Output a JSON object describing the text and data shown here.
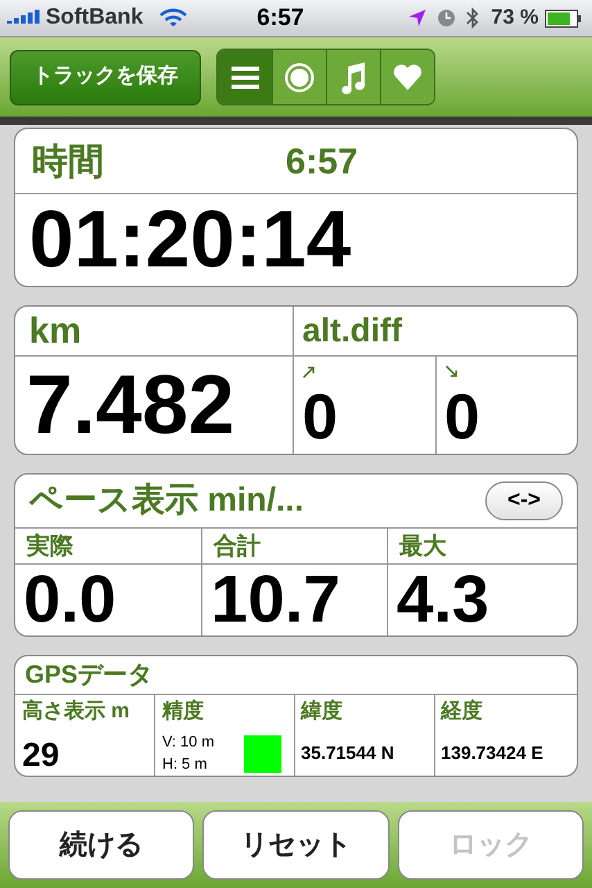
{
  "status_bar": {
    "carrier": "SoftBank",
    "time": "6:57",
    "battery": "73 %"
  },
  "toolbar": {
    "save_button": "トラックを保存",
    "segments": [
      {
        "kind": "list",
        "selected": true
      },
      {
        "kind": "record",
        "selected": false
      },
      {
        "kind": "music",
        "selected": false
      },
      {
        "kind": "heart",
        "selected": false
      }
    ]
  },
  "time_card": {
    "label": "時間",
    "clock": "6:57",
    "value": "01:20:14"
  },
  "distance_card": {
    "label": "km",
    "value": "7.482"
  },
  "altitude_card": {
    "label": "alt.diff",
    "cells": [
      {
        "kind": "up",
        "value": "0"
      },
      {
        "kind": "down",
        "value": "0"
      }
    ]
  },
  "pace_card": {
    "title": "ペース表示 min/...",
    "toggle": "<->",
    "cells": [
      {
        "label": "実際",
        "value": "0.0"
      },
      {
        "label": "合計",
        "value": "10.7"
      },
      {
        "label": "最大",
        "value": "4.3"
      }
    ]
  },
  "gps_card": {
    "title": "GPSデータ",
    "altitude": {
      "label": "高さ表示 m",
      "value": "29"
    },
    "accuracy": {
      "label": "精度",
      "vertical": "V: 10 m",
      "horizontal": "H: 5 m",
      "color": "#00ff00"
    },
    "latitude": {
      "label": "緯度",
      "value": "35.71544 N"
    },
    "longitude": {
      "label": "経度",
      "value": "139.73424 E"
    }
  },
  "buttons": [
    {
      "label": "続ける",
      "disabled": false
    },
    {
      "label": "リセット",
      "disabled": false
    },
    {
      "label": "ロック",
      "disabled": true
    }
  ]
}
